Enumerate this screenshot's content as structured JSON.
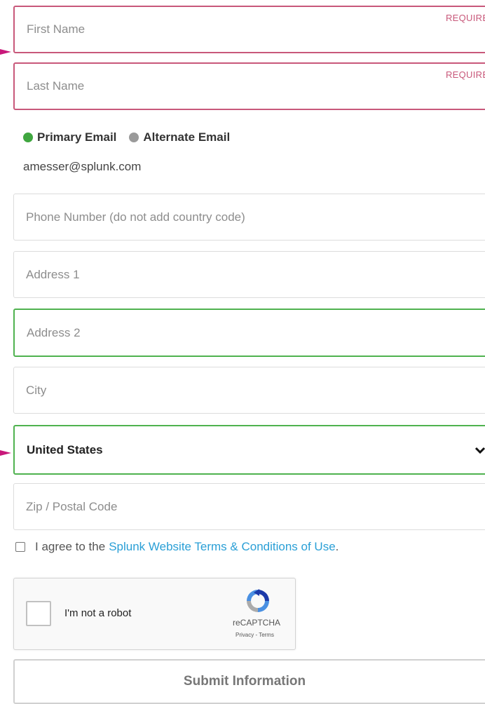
{
  "form": {
    "first_name": {
      "placeholder": "First Name",
      "required_label": "REQUIRED"
    },
    "last_name": {
      "placeholder": "Last Name",
      "required_label": "REQUIRED"
    },
    "email_options": {
      "primary": "Primary Email",
      "alternate": "Alternate Email",
      "selected": "primary"
    },
    "email_value": "amesser@splunk.com",
    "phone": {
      "placeholder": "Phone Number (do not add country code)"
    },
    "address1": {
      "placeholder": "Address 1"
    },
    "address2": {
      "placeholder": "Address 2"
    },
    "city": {
      "placeholder": "City"
    },
    "country": {
      "value": "United States"
    },
    "zip": {
      "placeholder": "Zip / Postal Code"
    },
    "agree": {
      "prefix": "I agree to the",
      "link": "Splunk Website Terms & Conditions of Use",
      "suffix": "."
    },
    "captcha": {
      "label": "I'm not a robot",
      "brand": "reCAPTCHA",
      "privacy_terms": "Privacy - Terms"
    },
    "submit_label": "Submit Information"
  },
  "colors": {
    "required": "#c8587a",
    "valid": "#4fb24f",
    "link": "#2a9fd6",
    "arrow": "#c8187a"
  },
  "icons": [
    "annotation-arrow-icon",
    "chevron-down-icon",
    "recaptcha-logo-icon"
  ]
}
